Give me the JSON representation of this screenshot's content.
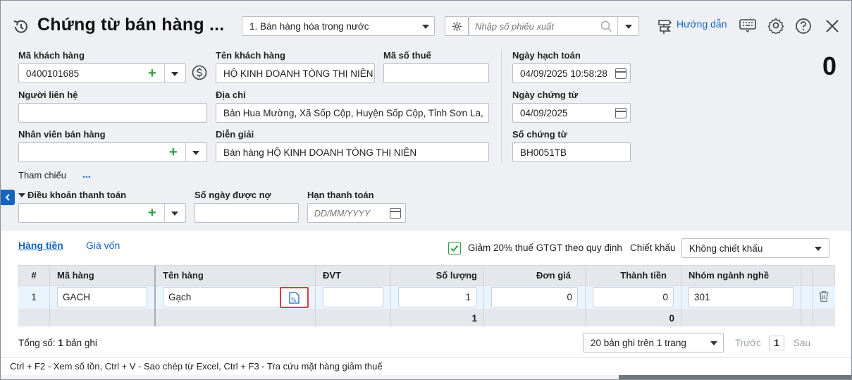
{
  "header": {
    "title": "Chứng từ bán hàng ...",
    "doc_type": "1. Bán hàng hóa trong nước",
    "search_placeholder": "Nhập số phiếu xuất",
    "help_label": "Hướng dẫn"
  },
  "form": {
    "customer_code_label": "Mã khách hàng",
    "customer_code": "0400101685",
    "customer_name_label": "Tên khách hàng",
    "customer_name": "HỘ KINH DOANH TÒNG THỊ NIÊN",
    "tax_code_label": "Mã số thuế",
    "tax_code": "",
    "contact_label": "Người liên hệ",
    "contact": "",
    "address_label": "Địa chỉ",
    "address": "Bản Hua Mường, Xã Sốp Cộp, Huyện Sốp Cộp, Tỉnh Sơn La, V",
    "salesperson_label": "Nhân viên bán hàng",
    "salesperson": "",
    "description_label": "Diễn giải",
    "description": "Bán hàng HỘ KINH DOANH TÒNG THỊ NIÊN",
    "reference_label": "Tham chiếu",
    "reference_more": "...",
    "payment_terms_label": "Điều khoản thanh toán",
    "payment_terms": "",
    "credit_days_label": "Số ngày được nợ",
    "credit_days": "",
    "due_date_label": "Hạn thanh toán",
    "due_date_placeholder": "DD/MM/YYYY",
    "posting_date_label": "Ngày hạch toán",
    "posting_date": "04/09/2025 10:58:28",
    "voucher_date_label": "Ngày chứng từ",
    "voucher_date": "04/09/2025",
    "voucher_no_label": "Số chứng từ",
    "voucher_no": "BH0051TB",
    "total_amount": "0"
  },
  "tabs": {
    "goods": "Hàng tiền",
    "cost": "Giá vốn"
  },
  "options": {
    "vat_reduction_label": "Giảm 20% thuế GTGT theo quy định",
    "vat_reduction_checked": true,
    "discount_label": "Chiết khấu",
    "discount_value": "Không chiết khấu"
  },
  "table": {
    "columns": [
      "#",
      "Mã hàng",
      "Tên hàng",
      "ĐVT",
      "Số lượng",
      "Đơn giá",
      "Thành tiền",
      "Nhóm ngành nghề"
    ],
    "rows": [
      {
        "no": "1",
        "code": "GACH",
        "name": "Gạch",
        "unit": "",
        "qty": "1",
        "price": "0",
        "amount": "0",
        "industry": "301"
      }
    ],
    "totals": {
      "qty": "1",
      "amount": "0"
    }
  },
  "footer": {
    "total_prefix": "Tổng số:",
    "total_count": "1",
    "total_suffix": "bản ghi",
    "page_size": "20 bản ghi trên 1 trang",
    "prev": "Trước",
    "page": "1",
    "next": "Sau",
    "shortcuts": "Ctrl + F2 - Xem số tồn, Ctrl + V - Sao chép từ Excel, Ctrl + F3 - Tra cứu mặt hàng giảm thuế"
  },
  "colors": {
    "accent": "#1565c0",
    "green": "#2e9e3f",
    "highlight_border": "#e53935"
  }
}
